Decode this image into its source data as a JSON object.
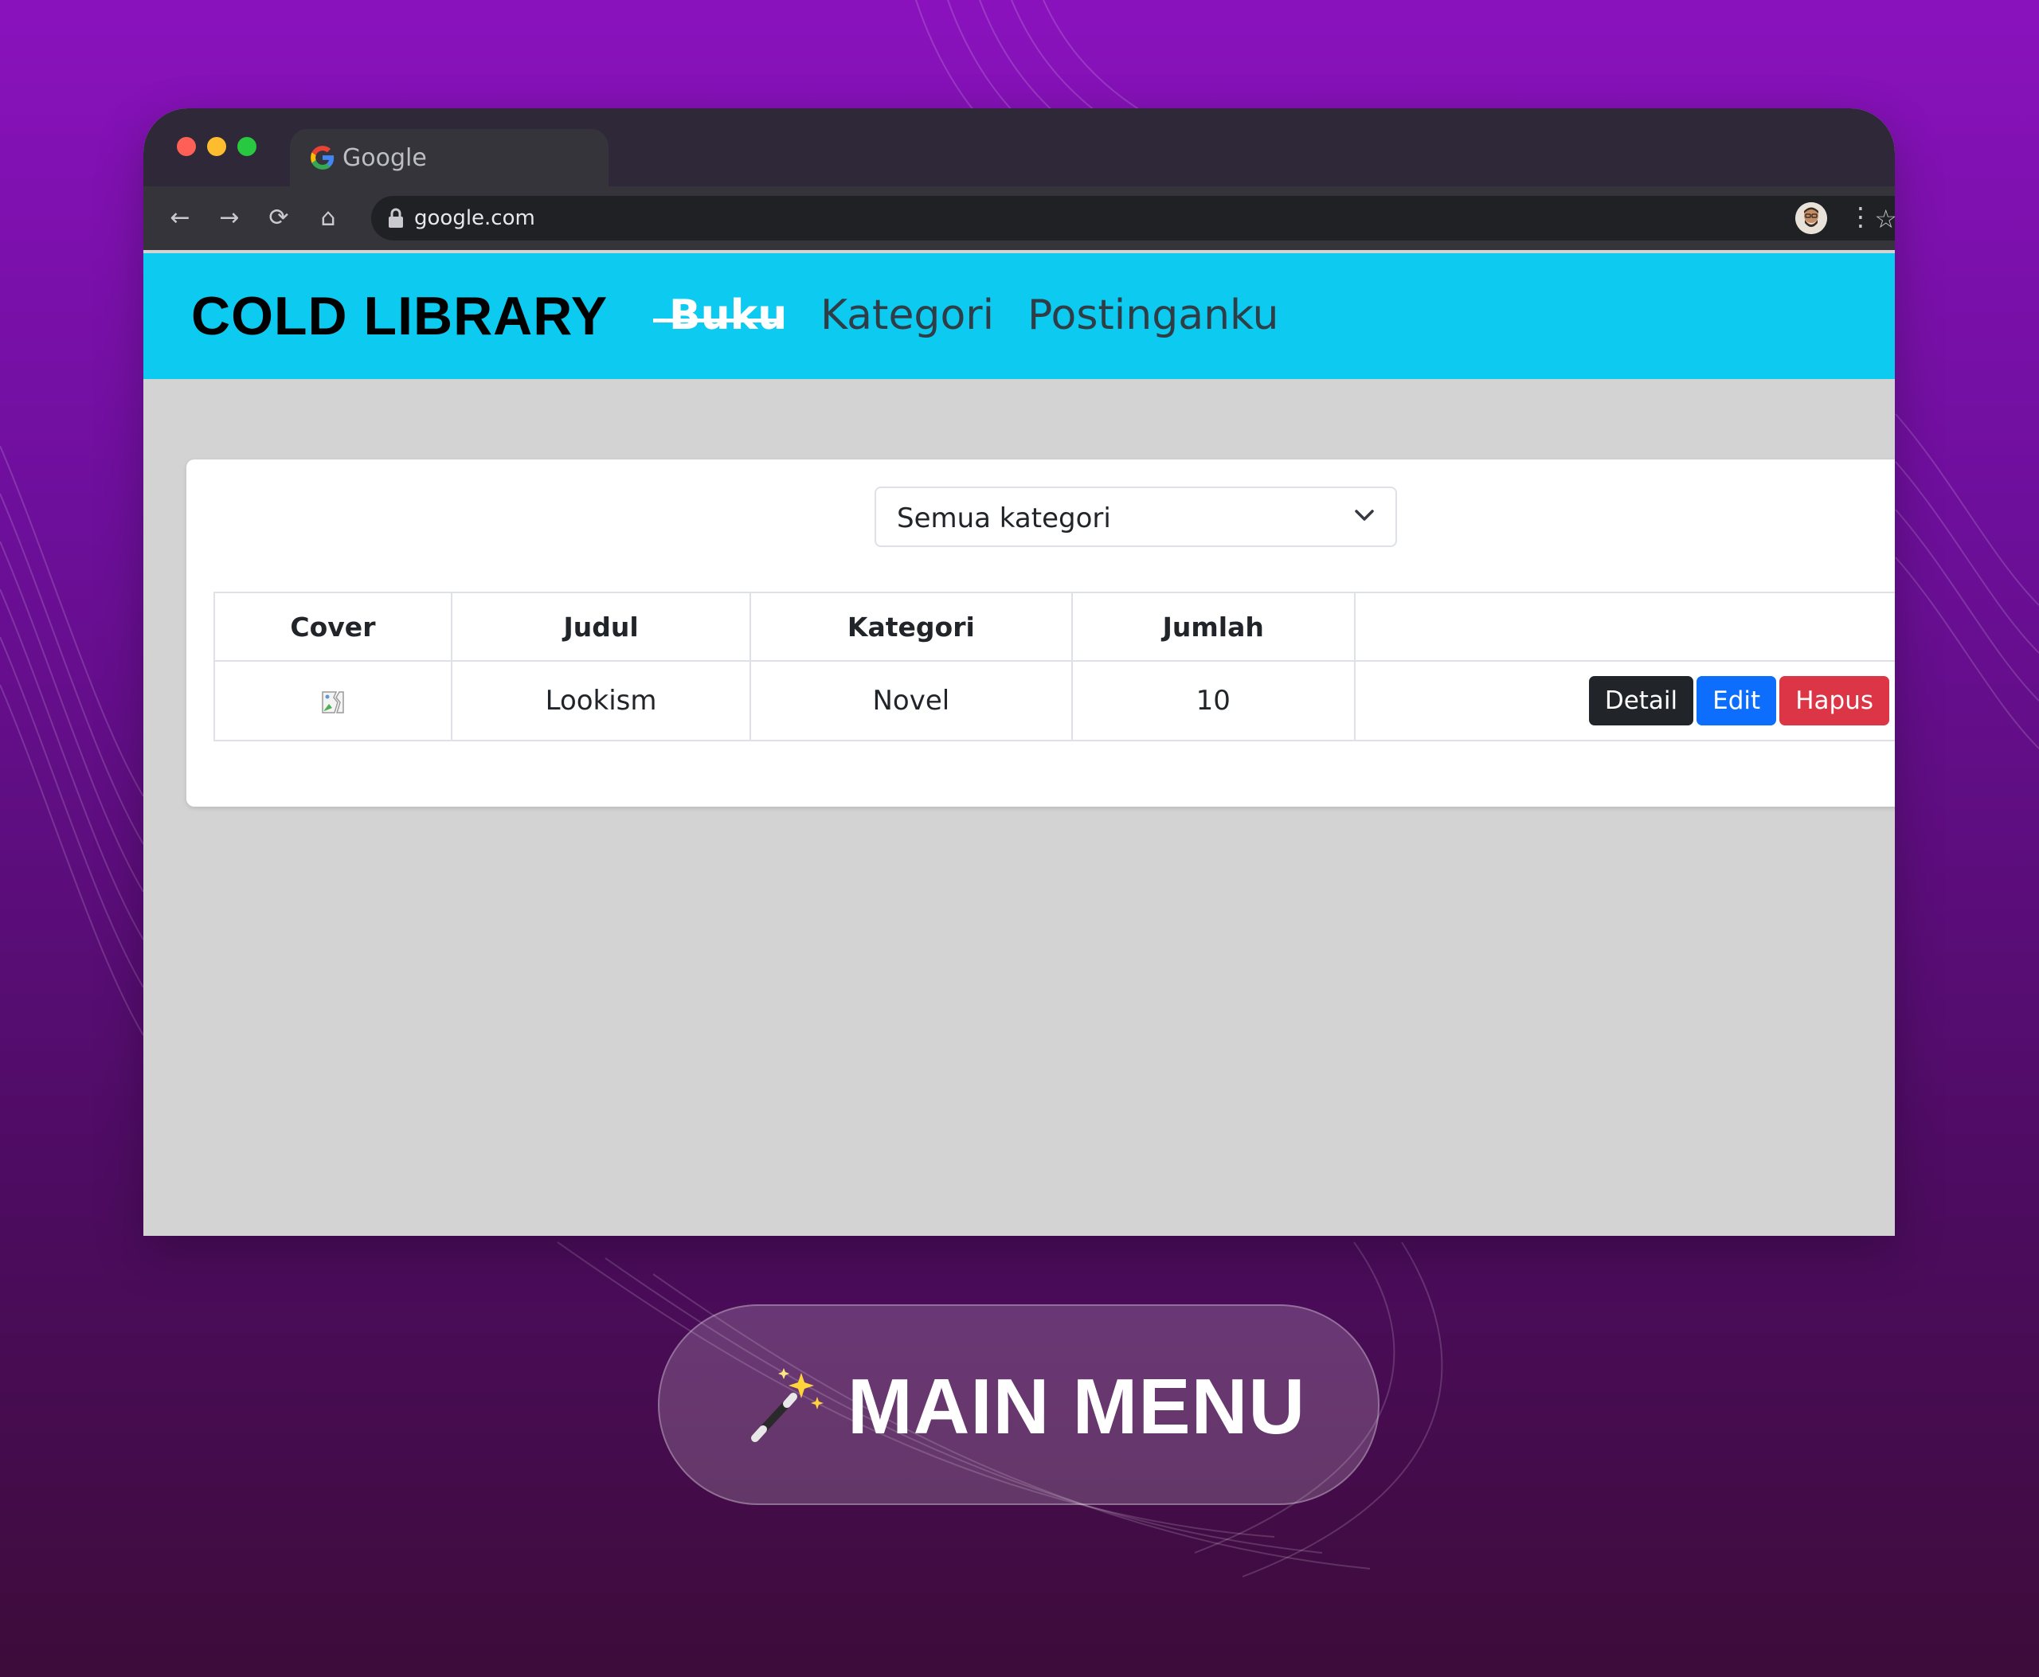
{
  "browser": {
    "tab_title": "Google",
    "url": "google.com"
  },
  "app": {
    "brand": "COLD LIBRARY",
    "nav": [
      {
        "label": "Buku",
        "active": true
      },
      {
        "label": "Kategori",
        "active": false
      },
      {
        "label": "Postinganku",
        "active": false
      }
    ]
  },
  "filter": {
    "selected": "Semua kategori"
  },
  "table": {
    "headers": [
      "Cover",
      "Judul",
      "Kategori",
      "Jumlah",
      ""
    ],
    "rows": [
      {
        "judul": "Lookism",
        "kategori": "Novel",
        "jumlah": "10"
      }
    ],
    "actions": {
      "detail": "Detail",
      "edit": "Edit",
      "hapus": "Hapus"
    }
  },
  "banner": {
    "label": "MAIN MENU",
    "icon": "magic-wand-icon"
  },
  "colors": {
    "navbar": "#0dcaf0",
    "detail_button": "#212529",
    "edit_button": "#0d6efd",
    "hapus_button": "#dc3545"
  }
}
